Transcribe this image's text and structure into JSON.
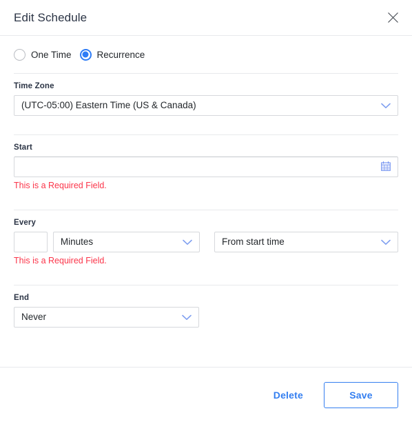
{
  "dialog": {
    "title": "Edit Schedule",
    "close_icon": "close-icon"
  },
  "schedule_type": {
    "options": [
      {
        "label": "One Time",
        "selected": false
      },
      {
        "label": "Recurrence",
        "selected": true
      }
    ]
  },
  "fields": {
    "time_zone": {
      "label": "Time Zone",
      "value": "(UTC-05:00) Eastern Time (US & Canada)"
    },
    "start": {
      "label": "Start",
      "value": "",
      "placeholder": "",
      "error": "This is a Required Field.",
      "icon": "calendar-icon"
    },
    "every": {
      "label": "Every",
      "count_value": "",
      "unit_value": "Minutes",
      "offset_value": "From start time",
      "error": "This is a Required Field."
    },
    "end": {
      "label": "End",
      "value": "Never"
    }
  },
  "footer": {
    "delete_label": "Delete",
    "save_label": "Save"
  },
  "colors": {
    "accent": "#337ef0",
    "radio_selected": "#2e7cf6",
    "error": "#fb3449",
    "chevron": "#7f9ff0",
    "border": "#d6d8dc",
    "divider": "#e8e9ec",
    "title": "#2b3445"
  }
}
